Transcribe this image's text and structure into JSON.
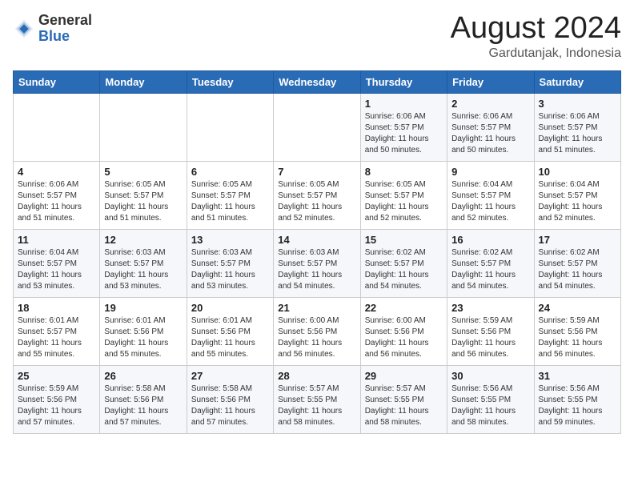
{
  "header": {
    "logo": {
      "general": "General",
      "blue": "Blue"
    },
    "title": "August 2024",
    "subtitle": "Gardutanjak, Indonesia"
  },
  "days_of_week": [
    "Sunday",
    "Monday",
    "Tuesday",
    "Wednesday",
    "Thursday",
    "Friday",
    "Saturday"
  ],
  "weeks": [
    [
      {
        "day": "",
        "info": ""
      },
      {
        "day": "",
        "info": ""
      },
      {
        "day": "",
        "info": ""
      },
      {
        "day": "",
        "info": ""
      },
      {
        "day": "1",
        "sunrise": "6:06 AM",
        "sunset": "5:57 PM",
        "daylight": "11 hours and 50 minutes."
      },
      {
        "day": "2",
        "sunrise": "6:06 AM",
        "sunset": "5:57 PM",
        "daylight": "11 hours and 50 minutes."
      },
      {
        "day": "3",
        "sunrise": "6:06 AM",
        "sunset": "5:57 PM",
        "daylight": "11 hours and 51 minutes."
      }
    ],
    [
      {
        "day": "4",
        "sunrise": "6:06 AM",
        "sunset": "5:57 PM",
        "daylight": "11 hours and 51 minutes."
      },
      {
        "day": "5",
        "sunrise": "6:05 AM",
        "sunset": "5:57 PM",
        "daylight": "11 hours and 51 minutes."
      },
      {
        "day": "6",
        "sunrise": "6:05 AM",
        "sunset": "5:57 PM",
        "daylight": "11 hours and 51 minutes."
      },
      {
        "day": "7",
        "sunrise": "6:05 AM",
        "sunset": "5:57 PM",
        "daylight": "11 hours and 52 minutes."
      },
      {
        "day": "8",
        "sunrise": "6:05 AM",
        "sunset": "5:57 PM",
        "daylight": "11 hours and 52 minutes."
      },
      {
        "day": "9",
        "sunrise": "6:04 AM",
        "sunset": "5:57 PM",
        "daylight": "11 hours and 52 minutes."
      },
      {
        "day": "10",
        "sunrise": "6:04 AM",
        "sunset": "5:57 PM",
        "daylight": "11 hours and 52 minutes."
      }
    ],
    [
      {
        "day": "11",
        "sunrise": "6:04 AM",
        "sunset": "5:57 PM",
        "daylight": "11 hours and 53 minutes."
      },
      {
        "day": "12",
        "sunrise": "6:03 AM",
        "sunset": "5:57 PM",
        "daylight": "11 hours and 53 minutes."
      },
      {
        "day": "13",
        "sunrise": "6:03 AM",
        "sunset": "5:57 PM",
        "daylight": "11 hours and 53 minutes."
      },
      {
        "day": "14",
        "sunrise": "6:03 AM",
        "sunset": "5:57 PM",
        "daylight": "11 hours and 54 minutes."
      },
      {
        "day": "15",
        "sunrise": "6:02 AM",
        "sunset": "5:57 PM",
        "daylight": "11 hours and 54 minutes."
      },
      {
        "day": "16",
        "sunrise": "6:02 AM",
        "sunset": "5:57 PM",
        "daylight": "11 hours and 54 minutes."
      },
      {
        "day": "17",
        "sunrise": "6:02 AM",
        "sunset": "5:57 PM",
        "daylight": "11 hours and 54 minutes."
      }
    ],
    [
      {
        "day": "18",
        "sunrise": "6:01 AM",
        "sunset": "5:57 PM",
        "daylight": "11 hours and 55 minutes."
      },
      {
        "day": "19",
        "sunrise": "6:01 AM",
        "sunset": "5:56 PM",
        "daylight": "11 hours and 55 minutes."
      },
      {
        "day": "20",
        "sunrise": "6:01 AM",
        "sunset": "5:56 PM",
        "daylight": "11 hours and 55 minutes."
      },
      {
        "day": "21",
        "sunrise": "6:00 AM",
        "sunset": "5:56 PM",
        "daylight": "11 hours and 56 minutes."
      },
      {
        "day": "22",
        "sunrise": "6:00 AM",
        "sunset": "5:56 PM",
        "daylight": "11 hours and 56 minutes."
      },
      {
        "day": "23",
        "sunrise": "5:59 AM",
        "sunset": "5:56 PM",
        "daylight": "11 hours and 56 minutes."
      },
      {
        "day": "24",
        "sunrise": "5:59 AM",
        "sunset": "5:56 PM",
        "daylight": "11 hours and 56 minutes."
      }
    ],
    [
      {
        "day": "25",
        "sunrise": "5:59 AM",
        "sunset": "5:56 PM",
        "daylight": "11 hours and 57 minutes."
      },
      {
        "day": "26",
        "sunrise": "5:58 AM",
        "sunset": "5:56 PM",
        "daylight": "11 hours and 57 minutes."
      },
      {
        "day": "27",
        "sunrise": "5:58 AM",
        "sunset": "5:56 PM",
        "daylight": "11 hours and 57 minutes."
      },
      {
        "day": "28",
        "sunrise": "5:57 AM",
        "sunset": "5:55 PM",
        "daylight": "11 hours and 58 minutes."
      },
      {
        "day": "29",
        "sunrise": "5:57 AM",
        "sunset": "5:55 PM",
        "daylight": "11 hours and 58 minutes."
      },
      {
        "day": "30",
        "sunrise": "5:56 AM",
        "sunset": "5:55 PM",
        "daylight": "11 hours and 58 minutes."
      },
      {
        "day": "31",
        "sunrise": "5:56 AM",
        "sunset": "5:55 PM",
        "daylight": "11 hours and 59 minutes."
      }
    ]
  ],
  "labels": {
    "sunrise_prefix": "Sunrise: ",
    "sunset_prefix": "Sunset: ",
    "daylight_label": "Daylight: "
  }
}
